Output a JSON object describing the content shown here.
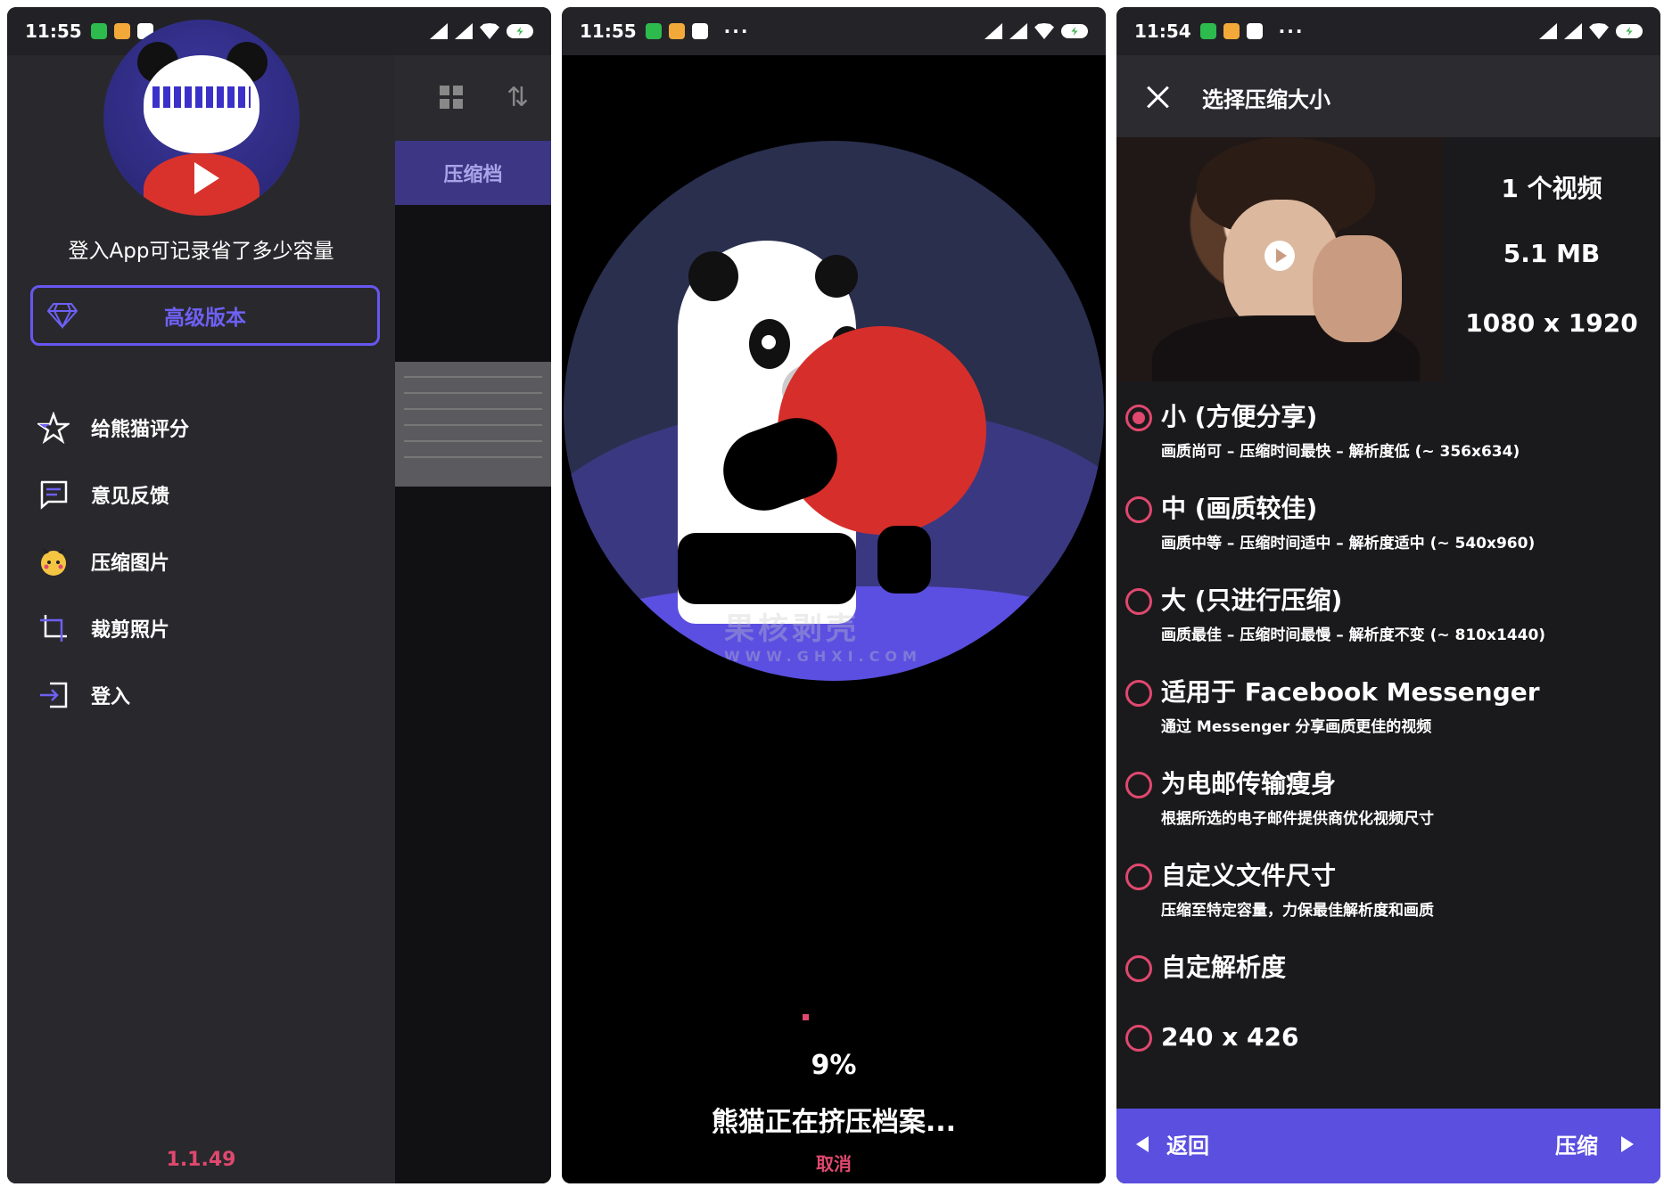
{
  "status_bar": {
    "phone1_time": "11:55",
    "phone2_time": "11:55",
    "phone3_time": "11:54",
    "dots": "···"
  },
  "drawer": {
    "login_hint": "登入App可记录省了多少容量",
    "premium_label": "高级版本",
    "menu": [
      {
        "label": "给熊猫评分",
        "icon": "star-icon"
      },
      {
        "label": "意见反馈",
        "icon": "feedback-icon"
      },
      {
        "label": "压缩图片",
        "icon": "pikachu-icon"
      },
      {
        "label": "裁剪照片",
        "icon": "crop-icon"
      },
      {
        "label": "登入",
        "icon": "login-icon"
      }
    ],
    "version": "1.1.49",
    "background_tab": "压缩档"
  },
  "progress": {
    "percent": "9%",
    "message": "熊猫正在挤压档案...",
    "cancel_label": "取消",
    "watermark": "果核剥壳",
    "watermark_url": "WWW.GHXI.COM"
  },
  "compress": {
    "title": "选择压缩大小",
    "video_count": "1 个视频",
    "file_size": "5.1 MB",
    "resolution": "1080 x 1920",
    "options": [
      {
        "title": "小 (方便分享)",
        "subtitle": "画质尚可 – 压缩时间最快 – 解析度低 (~ 356x634)",
        "selected": true
      },
      {
        "title": "中 (画质较佳)",
        "subtitle": "画质中等 – 压缩时间适中 – 解析度适中 (~ 540x960)",
        "selected": false
      },
      {
        "title": "大 (只进行压缩)",
        "subtitle": "画质最佳 – 压缩时间最慢 – 解析度不变 (~ 810x1440)",
        "selected": false
      },
      {
        "title": "适用于 Facebook Messenger",
        "subtitle": "通过 Messenger 分享画质更佳的视频",
        "selected": false
      },
      {
        "title": "为电邮传输瘦身",
        "subtitle": "根据所选的电子邮件提供商优化视频尺寸",
        "selected": false
      },
      {
        "title": "自定义文件尺寸",
        "subtitle": "压缩至特定容量，力保最佳解析度和画质",
        "selected": false
      },
      {
        "title": "自定解析度",
        "subtitle": "",
        "selected": false
      },
      {
        "title": "240 x 426",
        "subtitle": "",
        "selected": false
      }
    ],
    "back_label": "返回",
    "compress_label": "压缩"
  },
  "colors": {
    "accent": "#5b4fe0",
    "radio": "#e0486e",
    "drawer_bg": "#29292d"
  }
}
